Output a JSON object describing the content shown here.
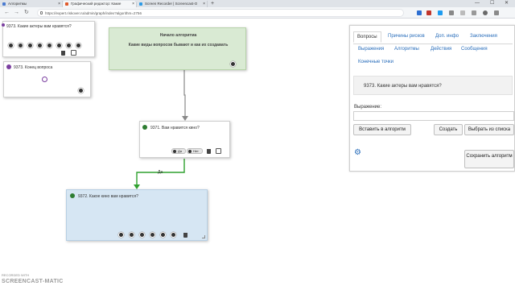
{
  "browser": {
    "tabs": [
      {
        "title": "Алгоритмы",
        "active": false,
        "color": "#4a7bd0"
      },
      {
        "title": "Графический редактор: Какие",
        "active": true,
        "color": "#e05a2b"
      },
      {
        "title": "Screen Recorder | Screencast-O",
        "active": false,
        "color": "#2e9be6"
      }
    ],
    "new_tab": "+",
    "window_controls": {
      "minimize": "—",
      "maximize": "☐",
      "close": "✕"
    },
    "url": "https://expert.riskover.ru/admin/graph/index?algorithm=2756",
    "nav": {
      "back": "←",
      "forward": "→",
      "reload": "↻"
    }
  },
  "diagram": {
    "nodes": {
      "node_top_left": {
        "title": "9373. Какие актеры вам нравятся?"
      },
      "node_end": {
        "title": "9373. Конец вопроса"
      },
      "node_start": {
        "title": "Начало алгоритма",
        "subtitle": "Какие виды вопросов бывают и как их создавать"
      },
      "node_mid": {
        "title": "9371. Вам нравится кино?",
        "answers": [
          "Да",
          "Нет"
        ]
      },
      "node_bottom": {
        "title": "9372. Какое кино вам нравится?"
      }
    },
    "edge_label": "Да",
    "colors": {
      "edge_gray": "#888888",
      "edge_green": "#2fa12f",
      "start_bg": "#d9ead3",
      "question_bg": "#d6e6f3"
    }
  },
  "panel": {
    "tabs": [
      "Вопросы",
      "Причины рисков",
      "Доп. инфо",
      "Заключения",
      "Выражения",
      "Алгоритмы",
      "Действия",
      "Сообщения",
      "Конечные точки"
    ],
    "selected_question": "9373. Какие актеры вам нравятся?",
    "expression_label": "Выражение:",
    "buttons": {
      "insert": "Вставить в алгоритм",
      "create": "Создать",
      "choose": "Выбрать из списка",
      "save": "Сохранить алгоритм"
    },
    "accent": "#2a6ebb"
  },
  "watermark": {
    "top": "RECORDED WITH",
    "brand": "SCREENCAST-MATIC"
  }
}
